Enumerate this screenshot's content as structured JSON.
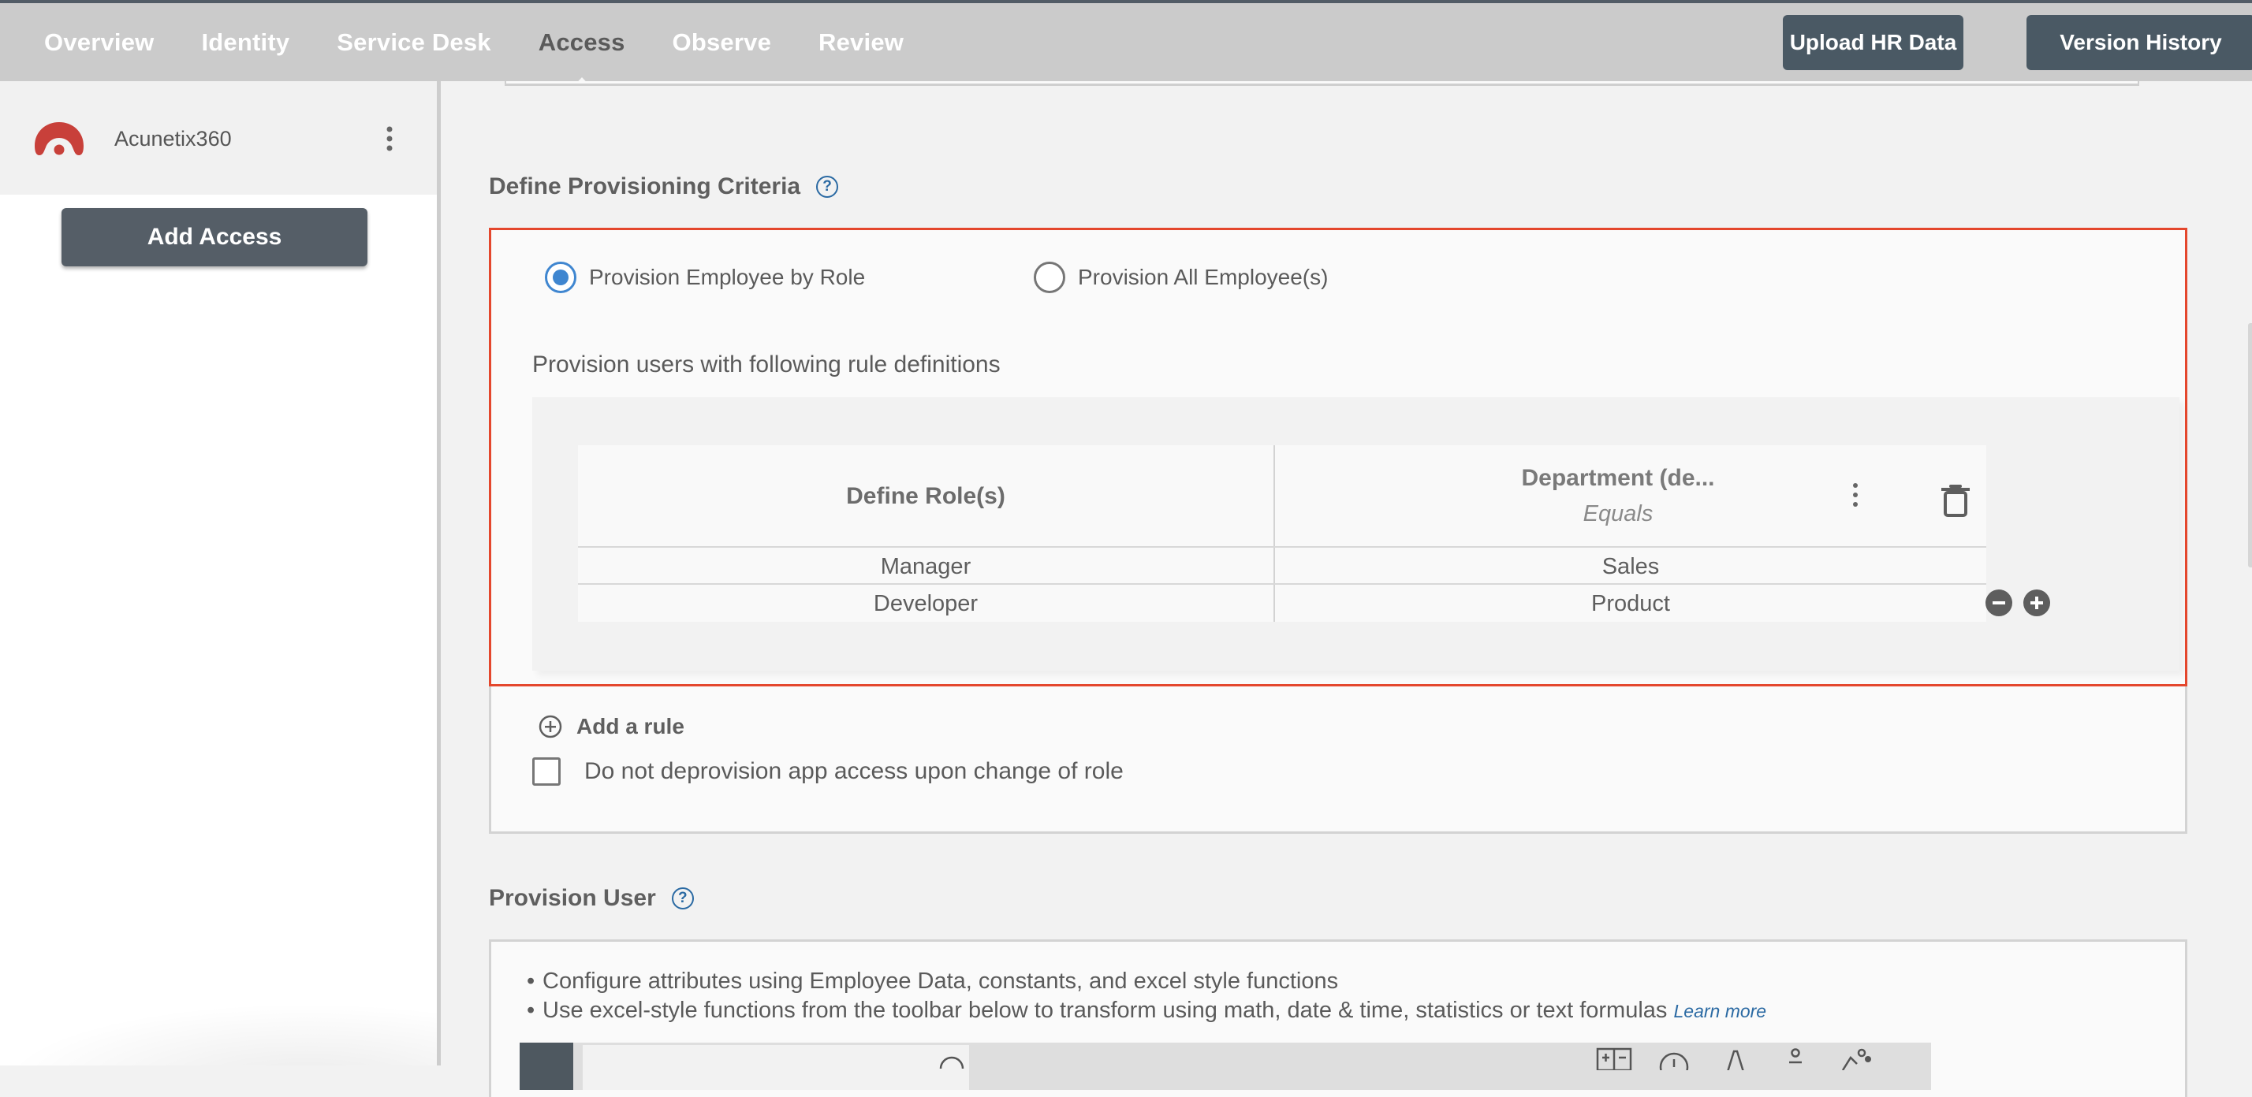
{
  "topnav": {
    "tabs": [
      {
        "label": "Overview",
        "active": false
      },
      {
        "label": "Identity",
        "active": false
      },
      {
        "label": "Service Desk",
        "active": false
      },
      {
        "label": "Access",
        "active": true
      },
      {
        "label": "Observe",
        "active": false
      },
      {
        "label": "Review",
        "active": false
      }
    ],
    "upload_hr_label": "Upload HR Data",
    "version_history_label": "Version History"
  },
  "sidebar": {
    "app_name": "Acunetix360",
    "app_logo_icon": "acunetix-logo-icon",
    "add_access_label": "Add Access"
  },
  "criteria": {
    "title": "Define Provisioning Criteria",
    "help_glyph": "?",
    "radio_by_role": {
      "label": "Provision Employee by Role",
      "checked": true
    },
    "radio_all": {
      "label": "Provision All Employee(s)",
      "checked": false
    },
    "caption": "Provision users with following rule definitions",
    "table": {
      "columns": [
        {
          "name": "Define Role(s)"
        },
        {
          "name": "Department (de...",
          "operator": "Equals"
        }
      ],
      "rows": [
        {
          "role": "Manager",
          "department": "Sales"
        },
        {
          "role": "Developer",
          "department": "Product"
        }
      ]
    },
    "add_rule_label": "Add a rule",
    "no_deprovision_label": "Do not deprovision app access upon change of role",
    "no_deprovision_checked": false,
    "highlight_color": "#e4472d"
  },
  "provision_user": {
    "title": "Provision User",
    "help_glyph": "?",
    "bullets": [
      "Configure attributes using Employee Data, constants, and excel style functions",
      "Use excel-style functions from the toolbar below to transform using math, date & time, statistics or text formulas"
    ],
    "learn_more_label": "Learn more"
  },
  "colors": {
    "accent_blue": "#3f86d0",
    "help_blue": "#2b6aa3",
    "button_dark": "#4a5964",
    "brand_red": "#c8403a"
  }
}
